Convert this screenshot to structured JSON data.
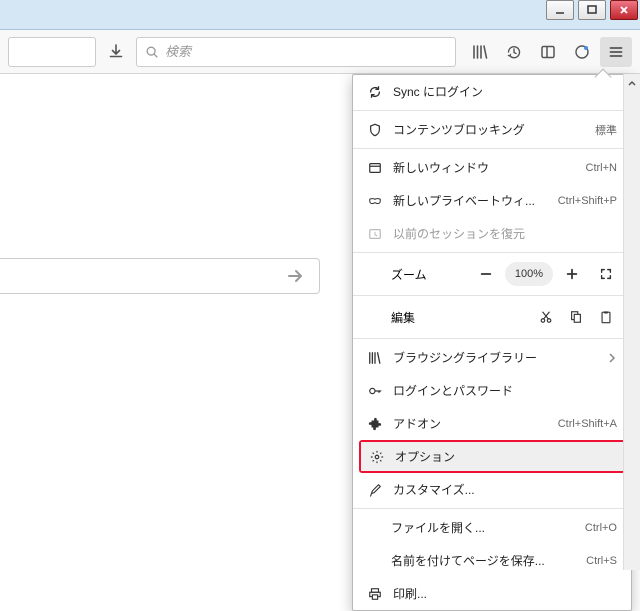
{
  "search_placeholder": "検索",
  "menu": {
    "sync": "Sync にログイン",
    "content_blocking": "コンテンツブロッキング",
    "content_blocking_level": "標準",
    "new_window": "新しいウィンドウ",
    "new_window_key": "Ctrl+N",
    "new_private": "新しいプライベートウィ...",
    "new_private_key": "Ctrl+Shift+P",
    "restore_session": "以前のセッションを復元",
    "zoom_label": "ズーム",
    "zoom_value": "100%",
    "edit_label": "編集",
    "library": "ブラウジングライブラリー",
    "logins": "ログインとパスワード",
    "addons": "アドオン",
    "addons_key": "Ctrl+Shift+A",
    "options": "オプション",
    "customize": "カスタマイズ...",
    "open_file": "ファイルを開く...",
    "open_file_key": "Ctrl+O",
    "save_as": "名前を付けてページを保存...",
    "save_as_key": "Ctrl+S",
    "print": "印刷..."
  }
}
